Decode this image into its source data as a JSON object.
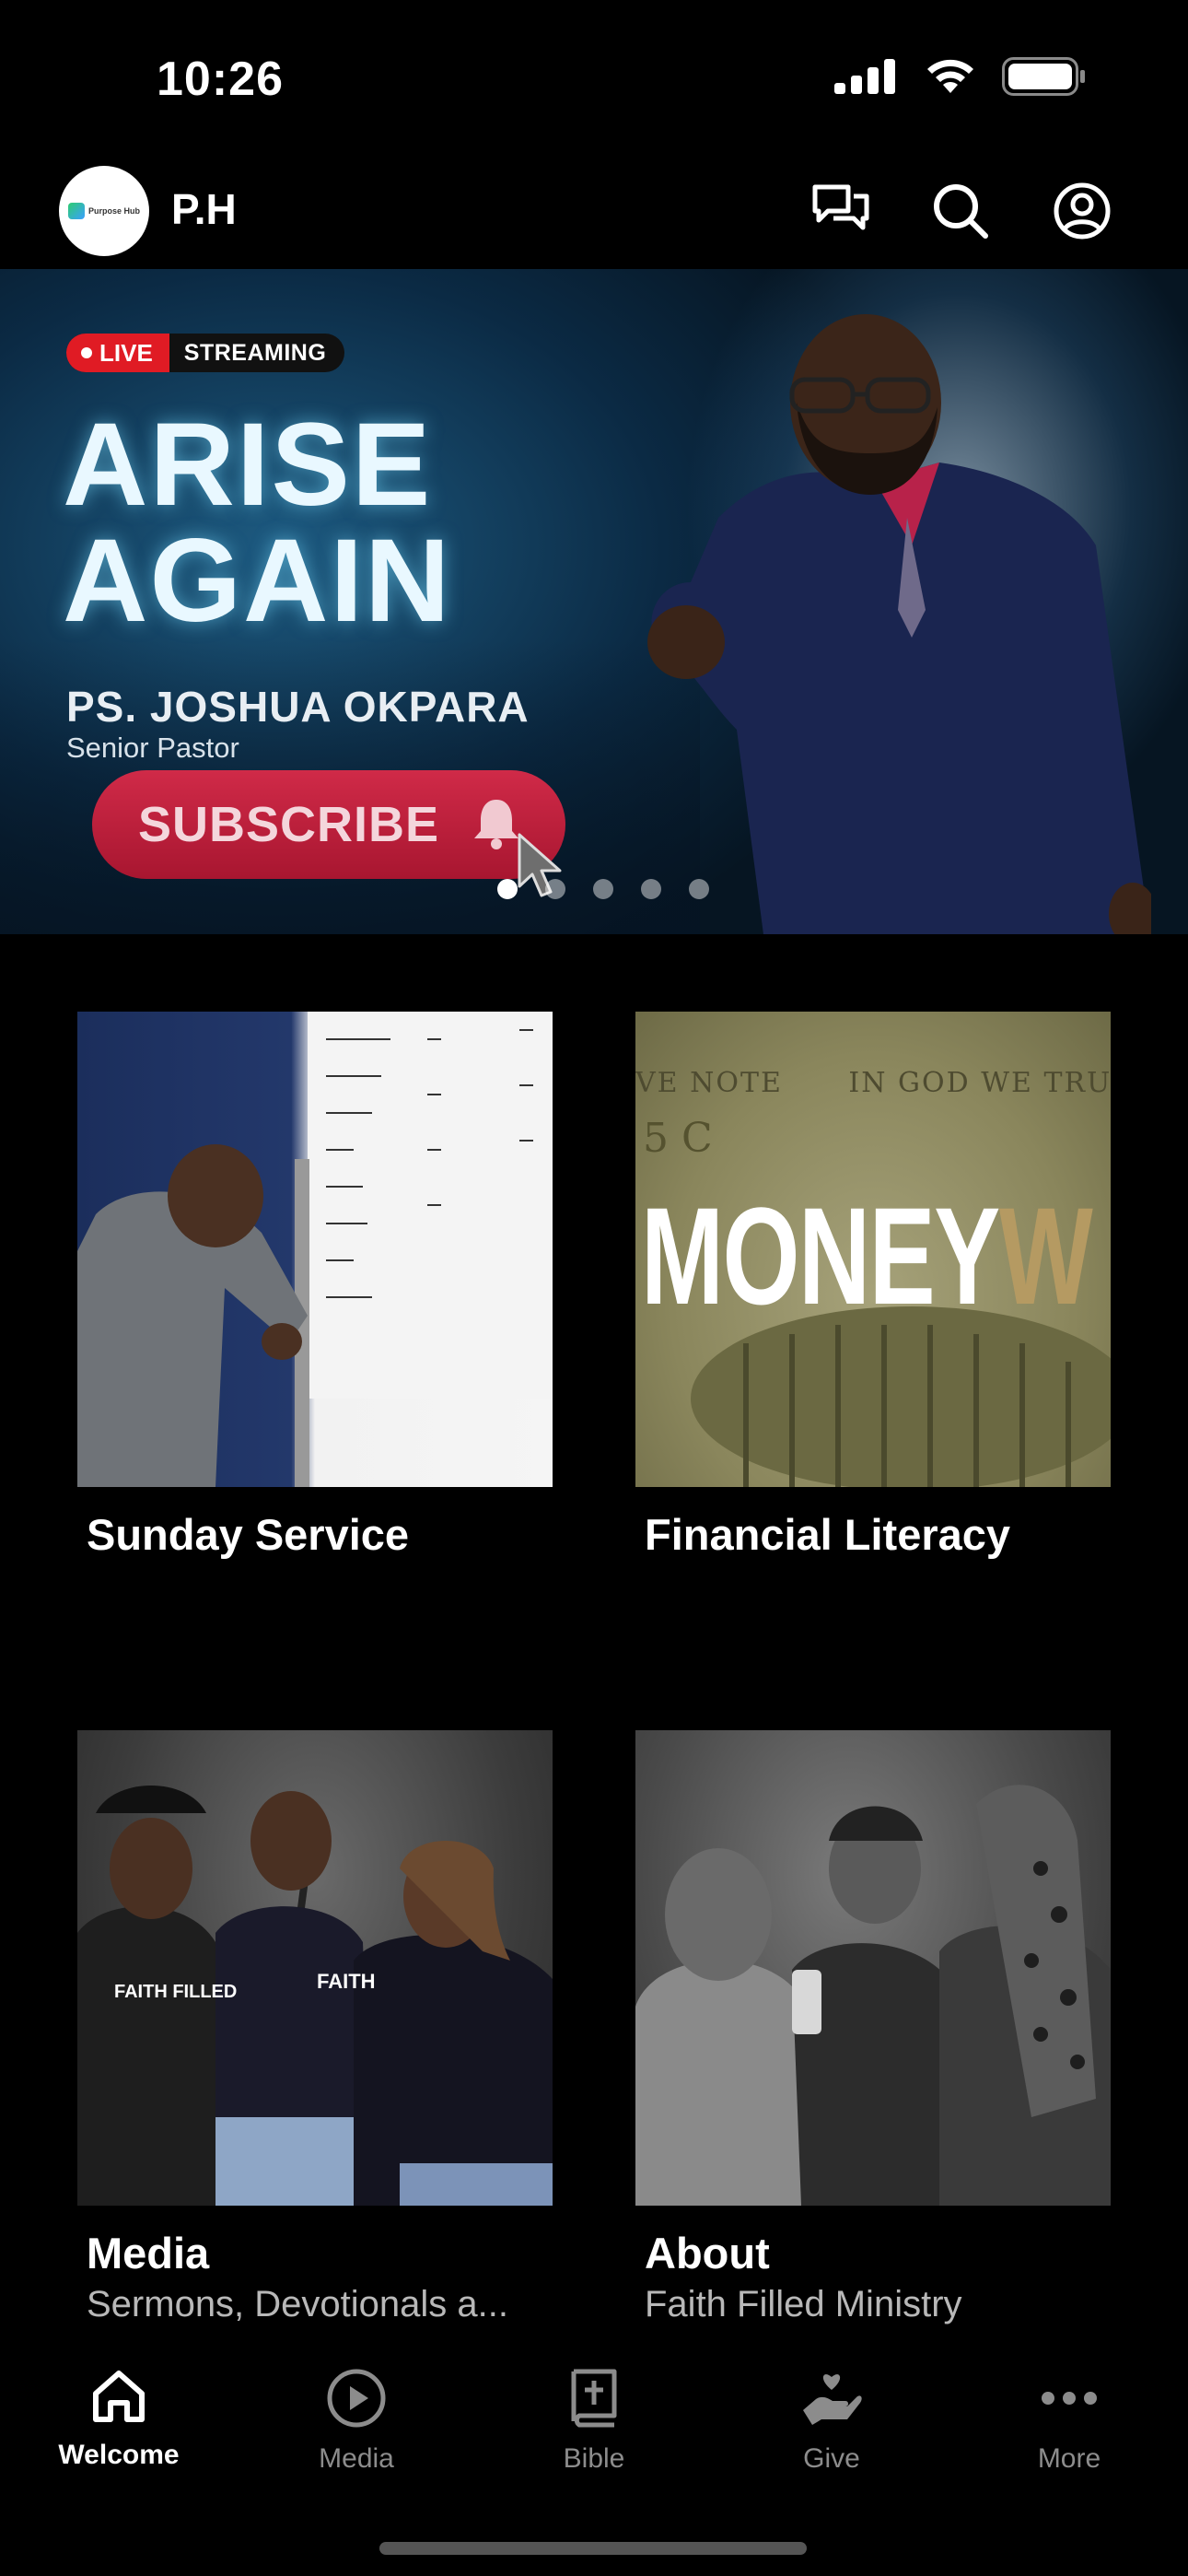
{
  "status_bar": {
    "time": "10:26"
  },
  "header": {
    "logo_text": "Purpose Hub",
    "title": "P.H"
  },
  "hero": {
    "live_label": "LIVE",
    "streaming_label": "STREAMING",
    "title_line1": "ARISE",
    "title_line2": "AGAIN",
    "speaker_name": "PS. JOSHUA OKPARA",
    "speaker_role": "Senior Pastor",
    "subscribe_label": "SUBSCRIBE",
    "slide_count": 5,
    "active_slide": 1
  },
  "cards": [
    {
      "title": "Sunday Service",
      "subtitle": ""
    },
    {
      "title": "Financial Literacy",
      "subtitle": "",
      "image_text_main": "MONEY",
      "image_text_accent": "W",
      "banknote_text_1": "VE NOTE",
      "banknote_text_2": "IN GOD WE TRU",
      "banknote_text_3": "5 C"
    },
    {
      "title": "Media",
      "subtitle": "Sermons, Devotionals a..."
    },
    {
      "title": "About",
      "subtitle": "Faith Filled Ministry"
    }
  ],
  "tabs": [
    {
      "label": "Welcome",
      "icon": "home-icon",
      "active": true
    },
    {
      "label": "Media",
      "icon": "play-circle-icon",
      "active": false
    },
    {
      "label": "Bible",
      "icon": "bible-icon",
      "active": false
    },
    {
      "label": "Give",
      "icon": "give-hand-heart-icon",
      "active": false
    },
    {
      "label": "More",
      "icon": "more-dots-icon",
      "active": false
    }
  ],
  "colors": {
    "live_red": "#e01b24",
    "subscribe": "#c0203d",
    "accent_gold": "#b59a62"
  }
}
